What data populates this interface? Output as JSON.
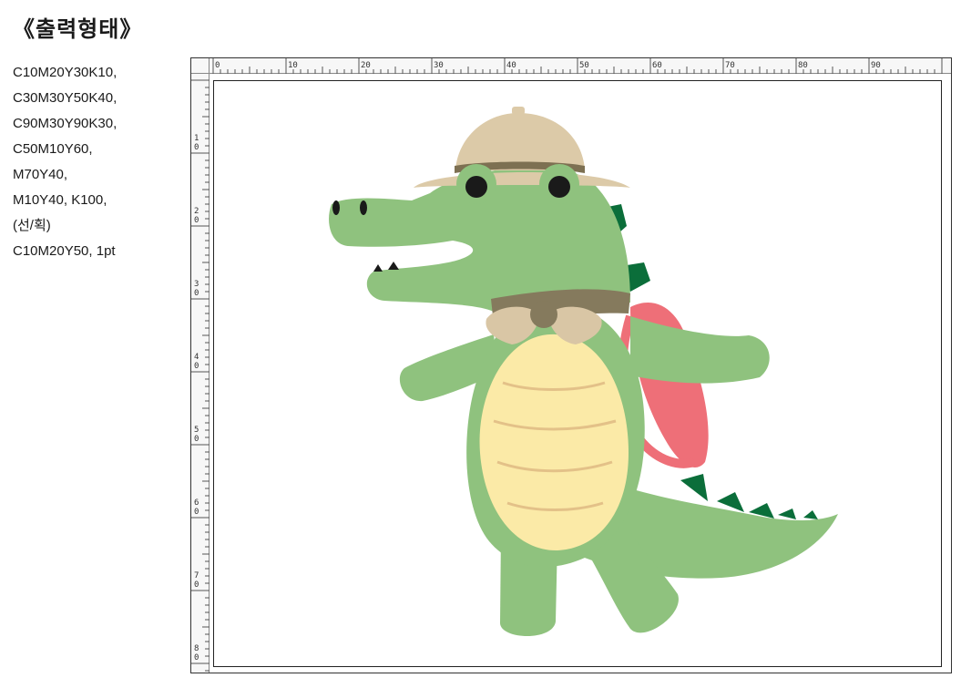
{
  "header": {
    "title": "《출력형태》"
  },
  "spec_lines": [
    "C10M20Y30K10,",
    "C30M30Y50K40,",
    "C90M30Y90K30,",
    "C50M10Y60,",
    "M70Y40,",
    "M10Y40, K100,",
    "(선/획)",
    "C10M20Y50, 1pt"
  ],
  "ruler": {
    "top_labels": [
      "0",
      "10",
      "20",
      "30",
      "40",
      "50",
      "60",
      "70",
      "80",
      "90"
    ],
    "left_labels": [
      "1\n0",
      "2\n0",
      "3\n0",
      "4\n0",
      "5\n0",
      "6\n0",
      "7\n0",
      "8\n0"
    ]
  },
  "colors": {
    "body_green": "#8fc27e",
    "dark_green": "#0b6e3a",
    "belly": "#fbeaa7",
    "belly_line": "#e3c188",
    "hat": "#dccaa8",
    "hat_band": "#7d7052",
    "scarf_brown": "#857a5d",
    "bow": "#d9c6a5",
    "backpack": "#ee6f78",
    "outline": "#1a1a1a"
  }
}
